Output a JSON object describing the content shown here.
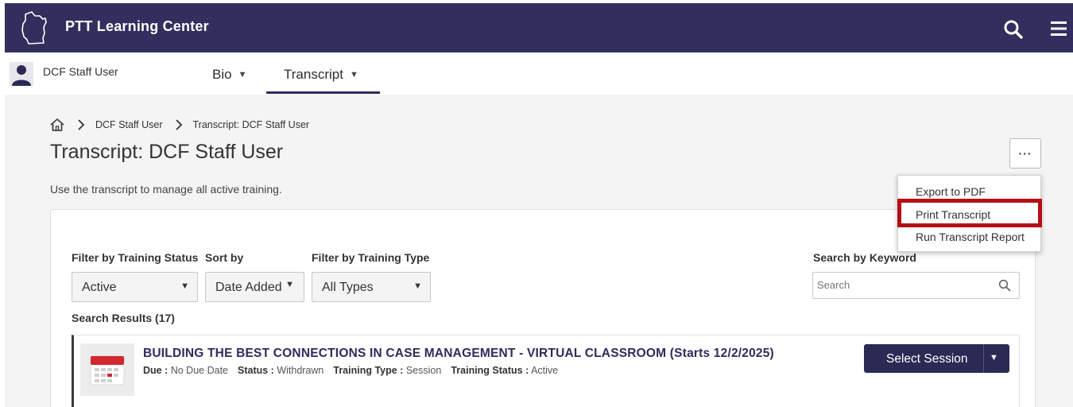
{
  "header": {
    "app_title": "PTT Learning Center",
    "logo_icon": "wisconsin-state-outline-icon",
    "search_icon": "search-icon",
    "menu_icon": "hamburger-menu-icon",
    "bg_color": "#322f5e"
  },
  "userbar": {
    "user_name": "DCF Staff User",
    "tabs": [
      {
        "label": "Bio",
        "active": false
      },
      {
        "label": "Transcript",
        "active": true
      }
    ]
  },
  "breadcrumb": {
    "items": [
      "DCF Staff User",
      "Transcript: DCF Staff User"
    ]
  },
  "page": {
    "title": "Transcript: DCF Staff User",
    "description": "Use the transcript to manage all active training.",
    "more_label": "···"
  },
  "options_menu": {
    "items": [
      "Export to PDF",
      "Print Transcript",
      "Run Transcript Report"
    ],
    "highlighted": "Print Transcript",
    "highlight_color": "#b40f17"
  },
  "filters": {
    "status_label": "Filter by Training Status",
    "status_value": "Active",
    "sort_label": "Sort by",
    "sort_value": "Date Added",
    "type_label": "Filter by Training Type",
    "type_value": "All Types",
    "keyword_label": "Search by Keyword",
    "keyword_placeholder": "Search"
  },
  "results": {
    "label": "Search Results (17)",
    "items": [
      {
        "title": "BUILDING THE BEST CONNECTIONS IN CASE MANAGEMENT - VIRTUAL CLASSROOM (Starts 12/2/2025)",
        "due_label": "Due :",
        "due_value": "No Due Date",
        "status_label": "Status :",
        "status_value": "Withdrawn",
        "type_label": "Training Type :",
        "type_value": "Session",
        "training_status_label": "Training Status :",
        "training_status_value": "Active",
        "thumb_icon": "calendar-icon",
        "action_label": "Select Session"
      }
    ]
  }
}
